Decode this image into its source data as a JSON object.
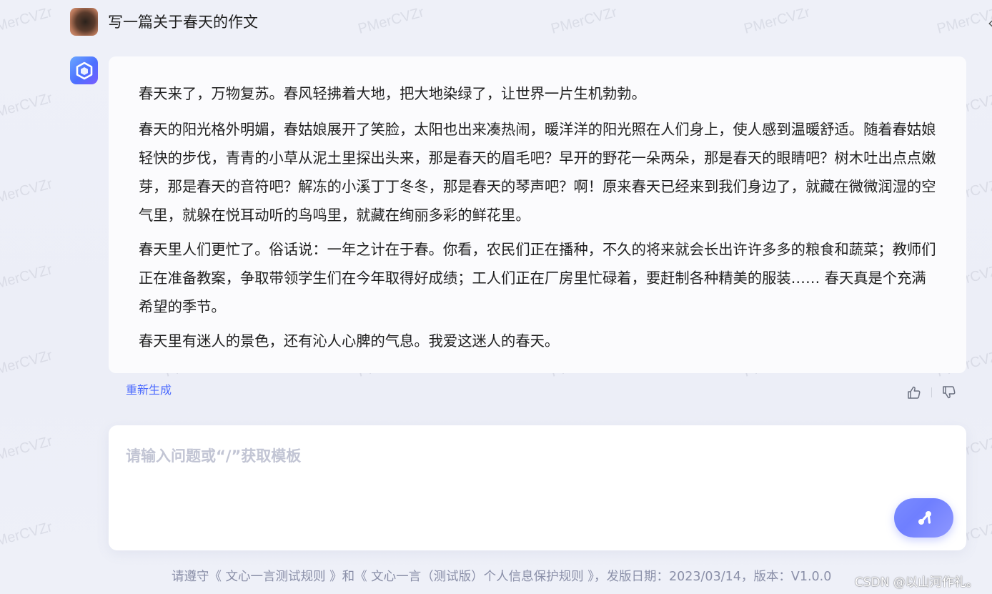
{
  "watermark": "PMerCVZr",
  "conversation": {
    "user_question": "写一篇关于春天的作文",
    "answer_paragraphs": [
      "春天来了，万物复苏。春风轻拂着大地，把大地染绿了，让世界一片生机勃勃。",
      "春天的阳光格外明媚，春姑娘展开了笑脸，太阳也出来凑热闹，暖洋洋的阳光照在人们身上，使人感到温暖舒适。随着春姑娘轻快的步伐，青青的小草从泥土里探出头来，那是春天的眉毛吧？早开的野花一朵两朵，那是春天的眼睛吧？树木吐出点点嫩芽，那是春天的音符吧？解冻的小溪丁丁冬冬，那是春天的琴声吧？啊！原来春天已经来到我们身边了，就藏在微微润湿的空气里，就躲在悦耳动听的鸟鸣里，就藏在绚丽多彩的鲜花里。",
      "春天里人们更忙了。俗话说：一年之计在于春。你看，农民们正在播种，不久的将来就会长出许许多多的粮食和蔬菜；教师们正在准备教案，争取带领学生们在今年取得好成绩；工人们正在厂房里忙碌着，要赶制各种精美的服装…… 春天真是个充满希望的季节。",
      "春天里有迷人的景色，还有沁人心脾的气息。我爱这迷人的春天。"
    ],
    "regenerate_label": "重新生成"
  },
  "input": {
    "placeholder": "请输入问题或“/”获取模板",
    "value": ""
  },
  "footer": {
    "rules_text": "请遵守《 文心一言测试规则 》和《 文心一言（测试版）个人信息保护规则 》，发版日期：2023/03/14，版本：V1.0.0",
    "csdn_tag": "CSDN @以山河作礼。"
  },
  "icons": {
    "bot_avatar": "cube-logo-icon",
    "like": "thumbs-up-icon",
    "dislike": "thumbs-down-icon",
    "send": "send-icon",
    "collapse": "chevron-left-icon"
  },
  "colors": {
    "accent": "#4d6bfe",
    "send_button": "#7b8cff",
    "placeholder": "#c2c5d4",
    "footer_text": "#8a8fa8"
  }
}
